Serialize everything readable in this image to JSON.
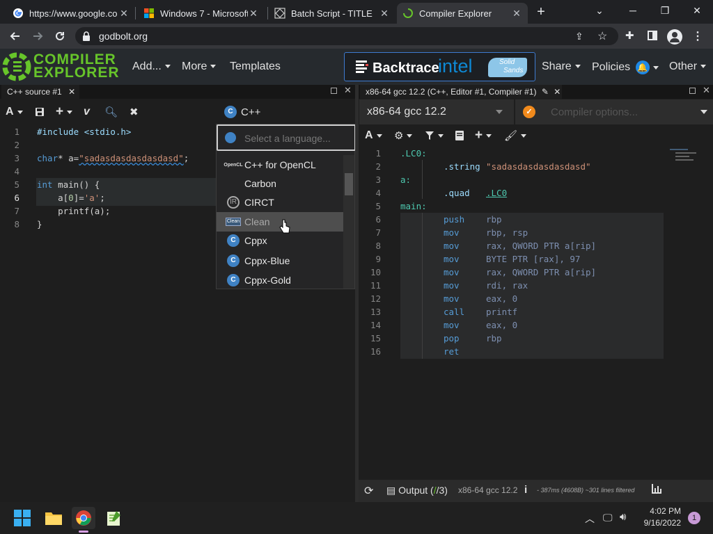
{
  "browser": {
    "tabs": [
      {
        "title": "https://www.google.co",
        "favicon": "google-g-icon",
        "active": false
      },
      {
        "title": "Windows 7 - Microsoft",
        "favicon": "microsoft-logo-icon",
        "active": false
      },
      {
        "title": "Batch Script - TITLE",
        "favicon": "site-diamond-icon",
        "active": false
      },
      {
        "title": "Compiler Explorer",
        "favicon": "loading-spinner-icon",
        "active": true
      }
    ],
    "new_tab": "+",
    "url": "godbolt.org"
  },
  "ce_nav": {
    "logo_line1": "COMPILER",
    "logo_line2": "EXPLORER",
    "add": "Add...",
    "more": "More",
    "templates": "Templates",
    "sponsor_backtrace": "Backtrace",
    "sponsor_intel": "intel",
    "sponsor_solid_1": "Solid",
    "sponsor_solid_2": "Sands",
    "share": "Share",
    "policies": "Policies",
    "other": "Other"
  },
  "editor": {
    "tab_title": "C++ source #1",
    "language": "C++",
    "line_numbers": [
      "1",
      "2",
      "3",
      "4",
      "5",
      "6",
      "7",
      "8"
    ],
    "lines": [
      "#include <stdio.h>",
      "",
      "char* a=\"sadasdasdasdasdasd\";",
      "",
      "int main() {",
      "    a[0]='a';",
      "    printf(a);",
      "}"
    ],
    "tokens": {
      "l1": "#include <stdio.h>",
      "l3_kw": "char",
      "l3_rest": "* a=",
      "l3_str": "\"sadasdasdasdasdasd\"",
      "l3_end": ";",
      "l5_kw": "int",
      "l5_rest": " main() {",
      "l6_pre": "    a[",
      "l6_num": "0",
      "l6_mid": "]=",
      "l6_str": "'a'",
      "l6_end": ";",
      "l7": "    printf(a);",
      "l8": "}"
    }
  },
  "language_dropdown": {
    "search_placeholder": "Select a language...",
    "items": [
      {
        "label": "C++ for OpenCL",
        "icon": "opencl-icon"
      },
      {
        "label": "Carbon",
        "icon": ""
      },
      {
        "label": "CIRCT",
        "icon": "circt-icon"
      },
      {
        "label": "Clean",
        "icon": "clean-icon"
      },
      {
        "label": "Cppx",
        "icon": "cpp-logo-icon"
      },
      {
        "label": "Cppx-Blue",
        "icon": "cpp-logo-icon"
      },
      {
        "label": "Cppx-Gold",
        "icon": "cpp-logo-icon"
      }
    ],
    "hovered_index": 3
  },
  "compiler": {
    "tab_title": "x86-64 gcc 12.2 (C++, Editor #1, Compiler #1)",
    "selected": "x86-64 gcc 12.2",
    "options_placeholder": "Compiler options...",
    "line_numbers": [
      "1",
      "2",
      "3",
      "4",
      "5",
      "6",
      "7",
      "8",
      "9",
      "10",
      "11",
      "12",
      "13",
      "14",
      "15",
      "16"
    ],
    "asm": [
      {
        "label": ".LC0:"
      },
      {
        "op": ".string",
        "args": "\"sadasdasdasdasdasd\""
      },
      {
        "label": "a:"
      },
      {
        "op": ".quad",
        "args": ".LC0"
      },
      {
        "label": "main:"
      },
      {
        "op": "push",
        "args": "rbp"
      },
      {
        "op": "mov",
        "args": "rbp, rsp"
      },
      {
        "op": "mov",
        "args": "rax, QWORD PTR a[rip]"
      },
      {
        "op": "mov",
        "args": "BYTE PTR [rax], 97"
      },
      {
        "op": "mov",
        "args": "rax, QWORD PTR a[rip]"
      },
      {
        "op": "mov",
        "args": "rdi, rax"
      },
      {
        "op": "mov",
        "args": "eax, 0"
      },
      {
        "op": "call",
        "args": "printf"
      },
      {
        "op": "mov",
        "args": "eax, 0"
      },
      {
        "op": "pop",
        "args": "rbp"
      },
      {
        "op": "ret",
        "args": ""
      }
    ]
  },
  "output_bar": {
    "output_label": "Output (",
    "output_ok": "/",
    "output_count": "/3)",
    "compiler": "x86-64 gcc 12.2",
    "info_icon": "i",
    "stats": "- 387ms (4608B) ~301 lines filtered"
  },
  "taskbar": {
    "time": "4:02 PM",
    "date": "9/16/2022",
    "notification_count": "1"
  },
  "colors": {
    "accent_green": "#67c52a",
    "selection_blue": "#3e7bd0",
    "intel_blue": "#0e88d3",
    "warning_orange": "#f18a1c"
  }
}
